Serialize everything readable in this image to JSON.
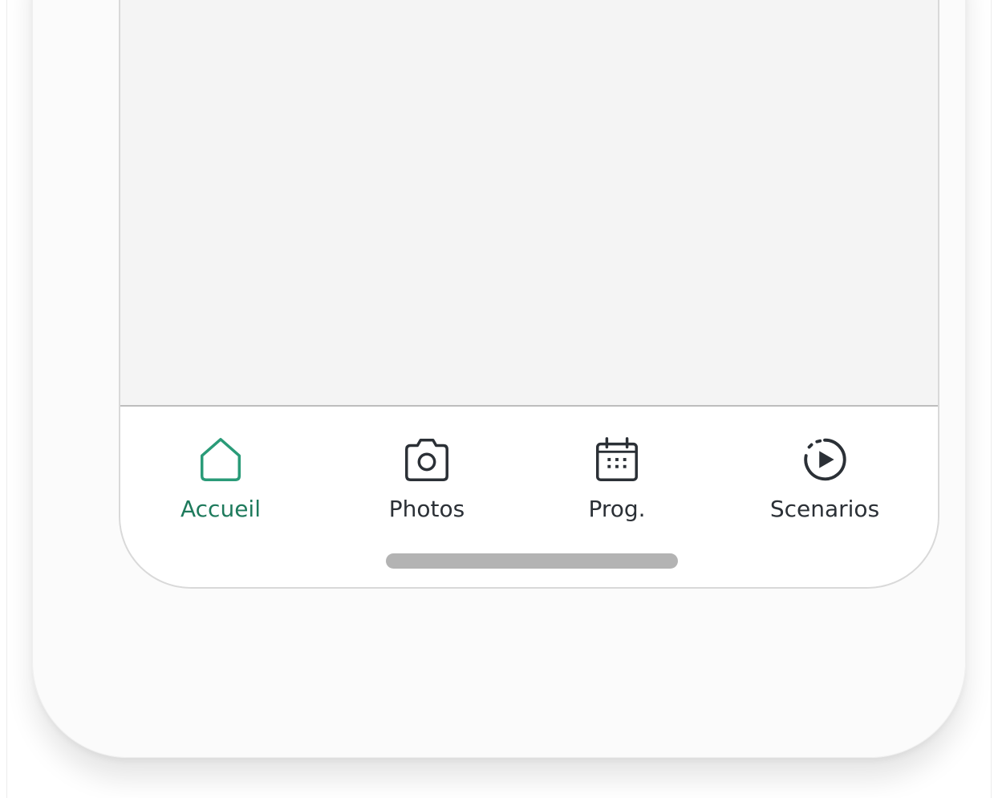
{
  "colors": {
    "accent": "#1e7a5c",
    "accent_icon": "#2a9b78",
    "orange": "#f07020",
    "icon_dark": "#2b3036",
    "screen_bg": "#f4f4f4"
  },
  "tabbar": {
    "tabs": [
      {
        "label": "Accueil",
        "icon": "home-icon",
        "active": true
      },
      {
        "label": "Photos",
        "icon": "camera-icon",
        "active": false
      },
      {
        "label": "Prog.",
        "icon": "calendar-icon",
        "active": false
      },
      {
        "label": "Scenarios",
        "icon": "scenario-play-icon",
        "active": false
      }
    ]
  }
}
